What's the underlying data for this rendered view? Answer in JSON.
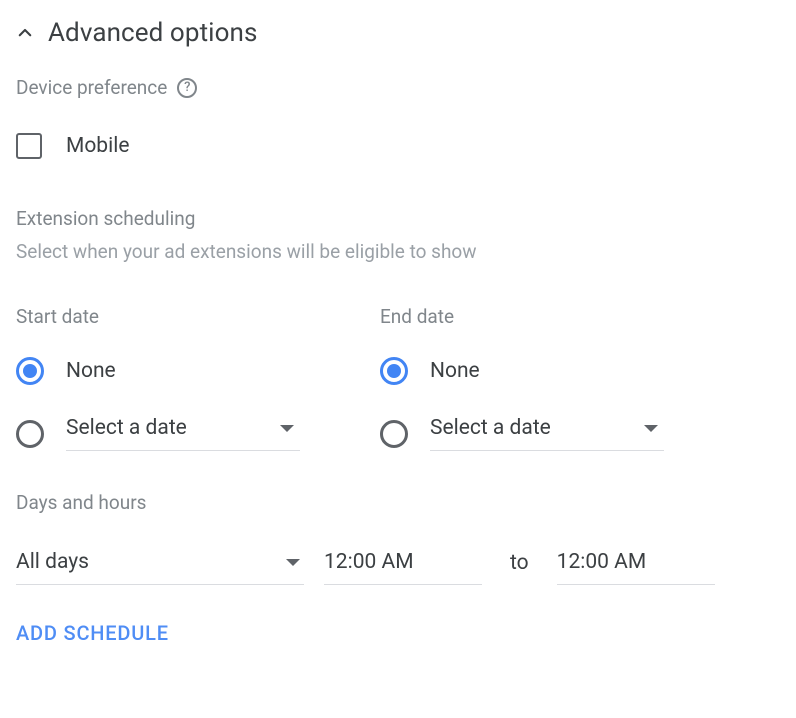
{
  "header": {
    "title": "Advanced options"
  },
  "device_preference": {
    "label": "Device preference",
    "mobile_label": "Mobile",
    "mobile_checked": false
  },
  "extension_scheduling": {
    "title": "Extension scheduling",
    "description": "Select when your ad extensions will be eligible to show",
    "start_date": {
      "label": "Start date",
      "none_label": "None",
      "select_label": "Select a date",
      "selected": "none"
    },
    "end_date": {
      "label": "End date",
      "none_label": "None",
      "select_label": "Select a date",
      "selected": "none"
    },
    "days_hours": {
      "label": "Days and hours",
      "days_value": "All days",
      "start_time": "12:00 AM",
      "to_label": "to",
      "end_time": "12:00 AM"
    },
    "add_schedule_label": "ADD SCHEDULE"
  }
}
